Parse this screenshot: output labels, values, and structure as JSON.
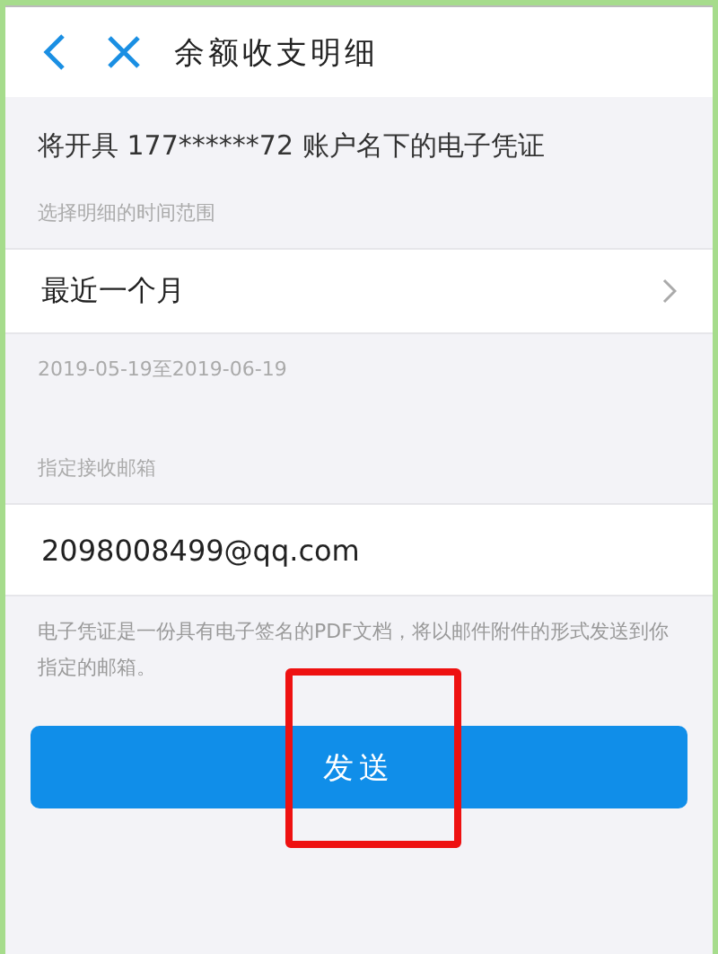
{
  "header": {
    "title": "余额收支明细"
  },
  "account_notice": "将开具 177******72 账户名下的电子凭证",
  "range": {
    "label": "选择明细的时间范围",
    "value": "最近一个月",
    "dates": "2019-05-19至2019-06-19"
  },
  "email": {
    "label": "指定接收邮箱",
    "value": "2098008499@qq.com"
  },
  "note": "电子凭证是一份具有电子签名的PDF文档，将以邮件附件的形式发送到你指定的邮箱。",
  "send_button": {
    "label": "发送",
    "highlighted": true
  }
}
